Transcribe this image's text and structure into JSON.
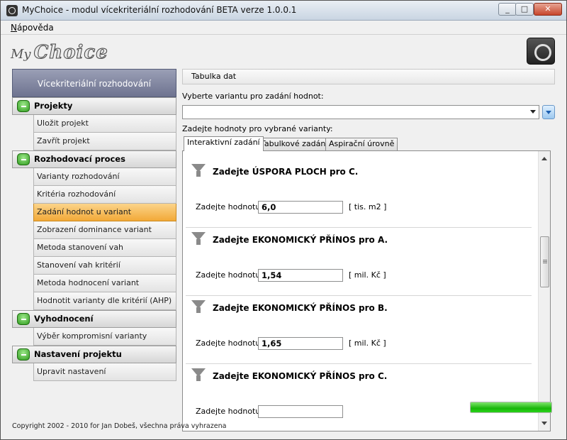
{
  "window": {
    "title": "MyChoice - modul vícekriteriální rozhodování BETA verze 1.0.0.1"
  },
  "menu": {
    "help_prefix": "N",
    "help_rest": "ápověda"
  },
  "logo": {
    "my": "My",
    "choice": "Choice"
  },
  "sidebar": {
    "header": "Vícekriteriální  rozhodování",
    "groups": [
      {
        "label": "Projekty",
        "items": [
          "Uložit projekt",
          "Zavřít projekt"
        ]
      },
      {
        "label": "Rozhodovací proces",
        "items": [
          "Varianty rozhodování",
          "Kritéria rozhodování",
          "Zadání hodnot u variant",
          "Zobrazení dominance variant",
          "Metoda stanovení vah",
          "Stanovení vah kritérií",
          "Metoda hodnocení variant",
          "Hodnotit varianty dle kritérií (AHP)"
        ]
      },
      {
        "label": "Vyhodnocení",
        "items": [
          "Výběr kompromisní varianty"
        ]
      },
      {
        "label": "Nastavení projektu",
        "items": [
          "Upravit nastavení"
        ]
      }
    ],
    "active_item": "Zadání hodnot u variant"
  },
  "main": {
    "panel_title": "Tabulka dat",
    "select_label": "Vyberte variantu pro zadání hodnot:",
    "select_value": "",
    "values_label": "Zadejte hodnoty pro vybrané varianty:",
    "tabs": [
      "Interaktivní zadání",
      "Tabulkové zadání",
      "Aspirační úrovně"
    ],
    "active_tab": "Interaktivní zadání",
    "entries": [
      {
        "title": "Zadejte ÚSPORA PLOCH pro C.",
        "label": "Zadejte hodnotu:",
        "value": "6,0",
        "unit": "[ tis. m2 ]"
      },
      {
        "title": "Zadejte EKONOMICKÝ PŘÍNOS pro A.",
        "label": "Zadejte hodnotu:",
        "value": "1,54",
        "unit": "[ mil. Kč ]"
      },
      {
        "title": "Zadejte EKONOMICKÝ PŘÍNOS pro B.",
        "label": "Zadejte hodnotu:",
        "value": "1,65",
        "unit": "[ mil. Kč ]"
      },
      {
        "title": "Zadejte EKONOMICKÝ PŘÍNOS pro C.",
        "label": "Zadejte hodnotu:",
        "value": "",
        "unit": ""
      }
    ]
  },
  "progress": {
    "value": 1.0
  },
  "footer": {
    "copyright": "Copyright 2002 - 2010 for Jan Dobeš, všechna práva vyhrazena"
  }
}
